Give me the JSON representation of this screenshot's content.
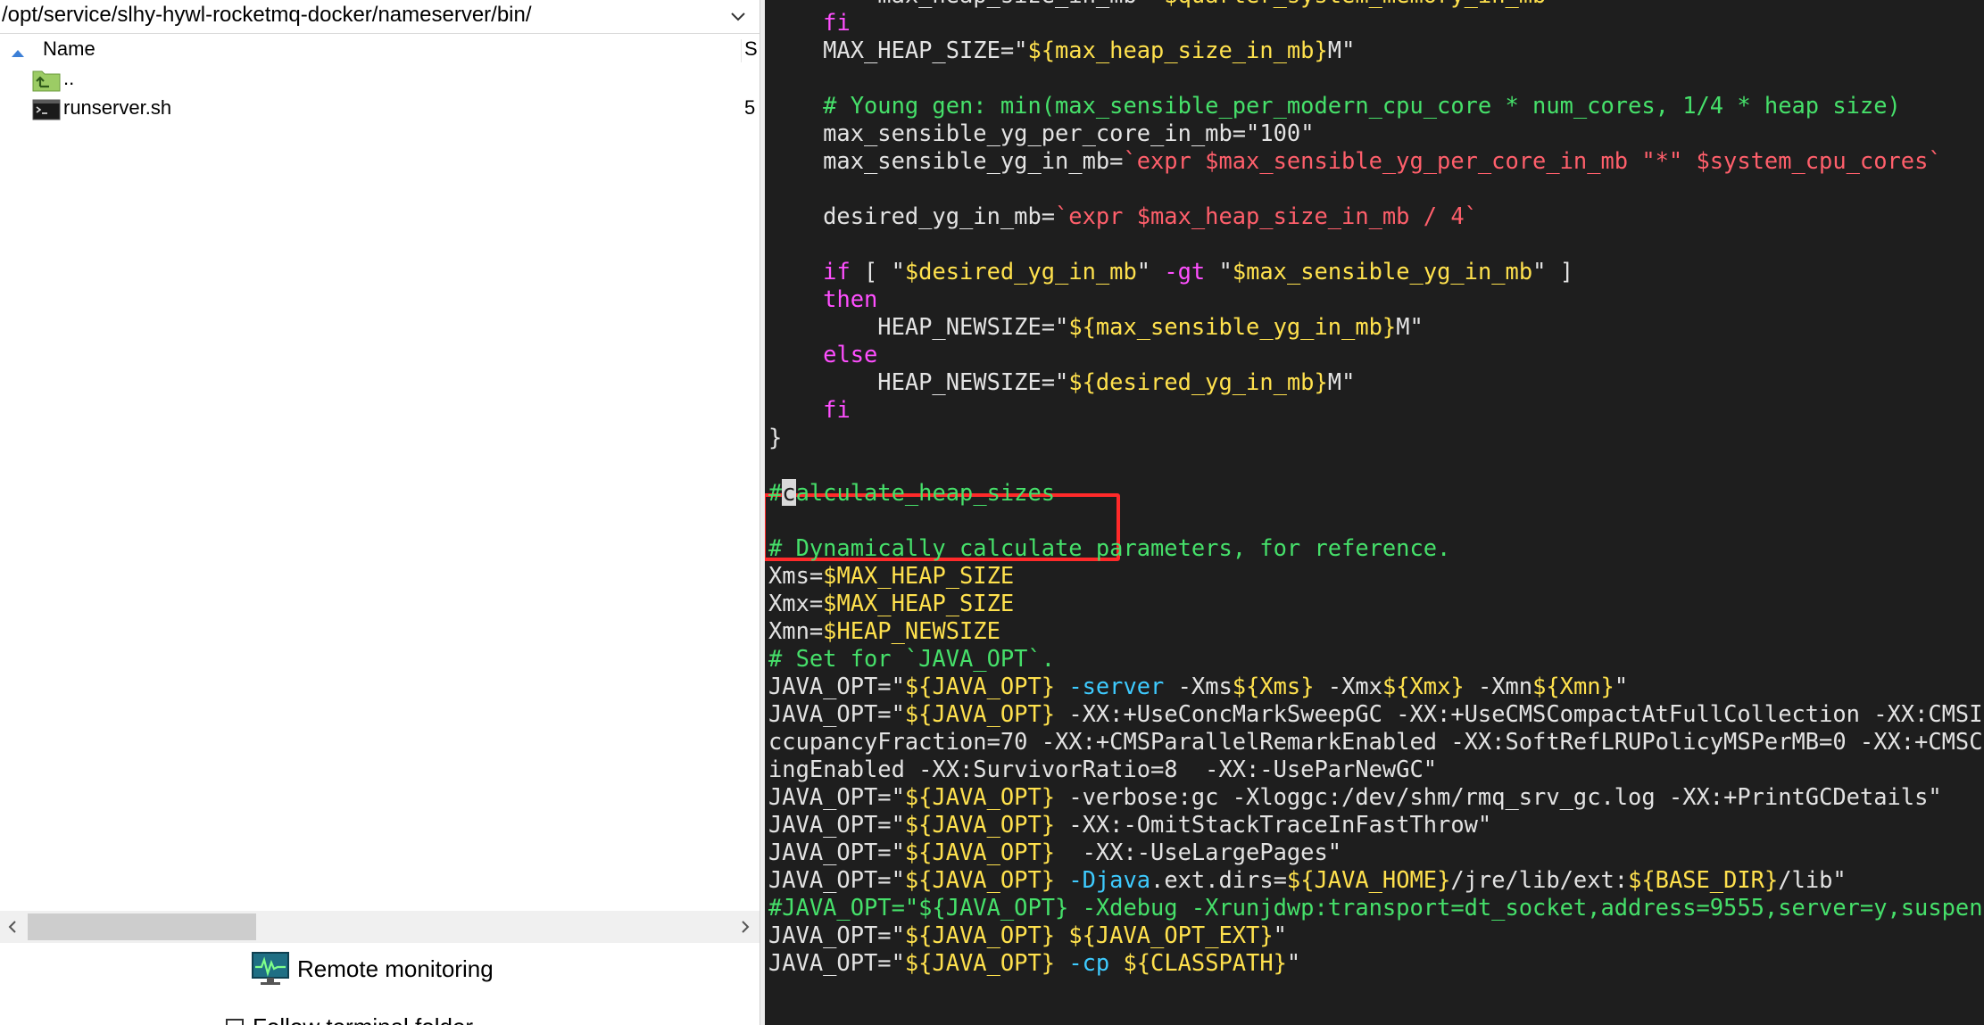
{
  "file_panel": {
    "path": "/opt/service/slhy-hywl-rocketmq-docker/nameserver/bin/",
    "columns": {
      "name": "Name",
      "size": "S"
    },
    "files": [
      {
        "name": "..",
        "size": "",
        "icon": "parent-folder-icon"
      },
      {
        "name": "runserver.sh",
        "size": "5",
        "icon": "terminal-script-icon"
      }
    ],
    "remote_monitoring_label": "Remote monitoring",
    "checkbox_label": "Follow terminal folder",
    "checkbox_checked": false
  },
  "terminal": {
    "lines": [
      {
        "text": "        max_heap_size_in_mb=\"$quarter_system_memory_in_mb\""
      },
      {
        "text": "    fi"
      },
      {
        "text": "    MAX_HEAP_SIZE=\"${max_heap_size_in_mb}M\""
      },
      {
        "text": ""
      },
      {
        "text": "    # Young gen: min(max_sensible_per_modern_cpu_core * num_cores, 1/4 * heap size)"
      },
      {
        "text": "    max_sensible_yg_per_core_in_mb=\"100\""
      },
      {
        "text": "    max_sensible_yg_in_mb=`expr $max_sensible_yg_per_core_in_mb \"*\" $system_cpu_cores`"
      },
      {
        "text": ""
      },
      {
        "text": "    desired_yg_in_mb=`expr $max_heap_size_in_mb / 4`"
      },
      {
        "text": ""
      },
      {
        "text": "    if [ \"$desired_yg_in_mb\" -gt \"$max_sensible_yg_in_mb\" ]"
      },
      {
        "text": "    then"
      },
      {
        "text": "        HEAP_NEWSIZE=\"${max_sensible_yg_in_mb}M\""
      },
      {
        "text": "    else"
      },
      {
        "text": "        HEAP_NEWSIZE=\"${desired_yg_in_mb}M\""
      },
      {
        "text": "    fi"
      },
      {
        "text": "}"
      },
      {
        "text": ""
      },
      {
        "text": "#calculate_heap_sizes"
      },
      {
        "text": ""
      },
      {
        "text": "# Dynamically calculate parameters, for reference."
      },
      {
        "text": "Xms=$MAX_HEAP_SIZE"
      },
      {
        "text": "Xmx=$MAX_HEAP_SIZE"
      },
      {
        "text": "Xmn=$HEAP_NEWSIZE"
      },
      {
        "text": "# Set for `JAVA_OPT`."
      },
      {
        "text": "JAVA_OPT=\"${JAVA_OPT} -server -Xms${Xms} -Xmx${Xmx} -Xmn${Xmn}\""
      },
      {
        "text": "JAVA_OPT=\"${JAVA_OPT} -XX:+UseConcMarkSweepGC -XX:+UseCMSCompactAtFullCollection -XX:CMSInitiatingO"
      },
      {
        "text": "ccupancyFraction=70 -XX:+CMSParallelRemarkEnabled -XX:SoftRefLRUPolicyMSPerMB=0 -XX:+CMSClassUnload"
      },
      {
        "text": "ingEnabled -XX:SurvivorRatio=8  -XX:-UseParNewGC\""
      },
      {
        "text": "JAVA_OPT=\"${JAVA_OPT} -verbose:gc -Xloggc:/dev/shm/rmq_srv_gc.log -XX:+PrintGCDetails\""
      },
      {
        "text": "JAVA_OPT=\"${JAVA_OPT} -XX:-OmitStackTraceInFastThrow\""
      },
      {
        "text": "JAVA_OPT=\"${JAVA_OPT}  -XX:-UseLargePages\""
      },
      {
        "text": "JAVA_OPT=\"${JAVA_OPT} -Djava.ext.dirs=${JAVA_HOME}/jre/lib/ext:${BASE_DIR}/lib\""
      },
      {
        "text": "#JAVA_OPT=\"${JAVA_OPT} -Xdebug -Xrunjdwp:transport=dt_socket,address=9555,server=y,suspend=n\""
      },
      {
        "text": "JAVA_OPT=\"${JAVA_OPT} ${JAVA_OPT_EXT}\""
      },
      {
        "text": "JAVA_OPT=\"${JAVA_OPT} -cp ${CLASSPATH}\""
      }
    ],
    "highlighted_line_index": 18
  },
  "colors": {
    "terminal_bg": "#1e1e1e",
    "keyword": "#ff4fff",
    "comment": "#46e06a",
    "string": "#ffe14d",
    "substitution": "#ff5f6b",
    "option": "#3ecbff",
    "highlight_border": "#ff2a2a"
  }
}
